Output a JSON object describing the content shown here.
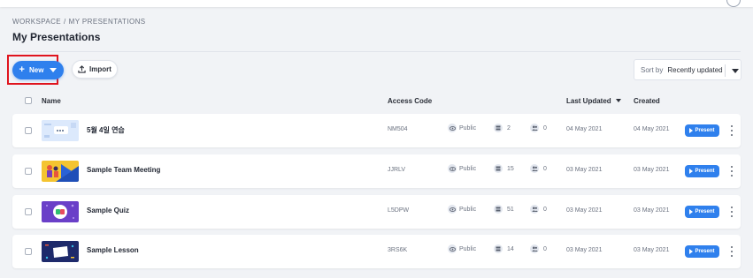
{
  "breadcrumb": [
    "WORKSPACE",
    "/",
    "MY PRESENTATIONS"
  ],
  "page_title": "My Presentations",
  "toolbar": {
    "new_label": "New",
    "import_label": "Import",
    "sort_label": "Sort by",
    "sort_value": "Recently updated"
  },
  "table_headers": {
    "name": "Name",
    "access_code": "Access Code",
    "last_updated": "Last Updated",
    "created": "Created"
  },
  "rows": [
    {
      "name": "5월 4일 연습",
      "code": "NM504",
      "visibility": "Public",
      "slides": "2",
      "participants": "0",
      "updated": "04 May 2021",
      "created": "04 May 2021",
      "action": "Present"
    },
    {
      "name": "Sample Team Meeting",
      "code": "JJRLV",
      "visibility": "Public",
      "slides": "15",
      "participants": "0",
      "updated": "03 May 2021",
      "created": "03 May 2021",
      "action": "Present"
    },
    {
      "name": "Sample Quiz",
      "code": "L5DPW",
      "visibility": "Public",
      "slides": "51",
      "participants": "0",
      "updated": "03 May 2021",
      "created": "03 May 2021",
      "action": "Present"
    },
    {
      "name": "Sample Lesson",
      "code": "3RS6K",
      "visibility": "Public",
      "slides": "14",
      "participants": "0",
      "updated": "03 May 2021",
      "created": "03 May 2021",
      "action": "Present"
    }
  ],
  "icons": {
    "new": "plus-icon",
    "import": "upload-icon",
    "visibility": "eye-icon",
    "slides": "slides-stack-icon",
    "participants": "people-icon",
    "present": "play-icon",
    "more": "kebab-menu-icon"
  },
  "colors": {
    "accent": "#2f80ed",
    "highlight_box": "#e0141e",
    "background": "#f1f3f6"
  }
}
